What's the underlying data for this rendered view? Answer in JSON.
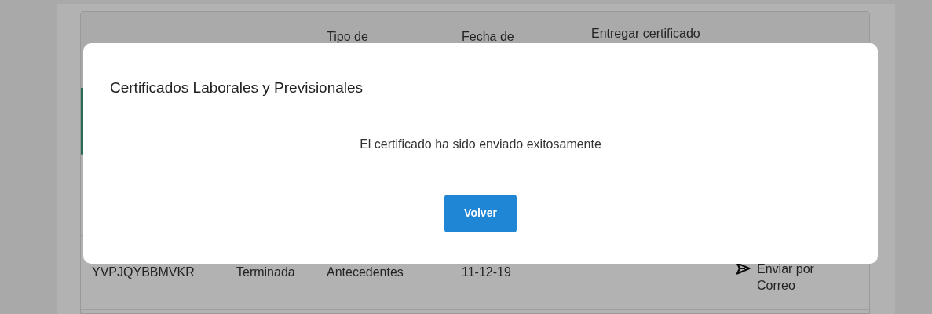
{
  "table": {
    "headers": [
      "Tipo de",
      "Fecha de",
      "Entregar certificado"
    ],
    "rows": [
      {
        "selected": true
      },
      {
        "selected": false
      },
      {
        "selected": false,
        "cells": [
          "YVPJQYBBMVKR",
          "Terminada",
          "Antecedentes",
          "11-12-19"
        ],
        "action": "Enviar por Correo"
      },
      {
        "selected": false
      }
    ]
  },
  "modal": {
    "title": "Certificados Laborales y Previsionales",
    "message": "El certificado ha sido enviado exitosamente",
    "button": "Volver"
  }
}
